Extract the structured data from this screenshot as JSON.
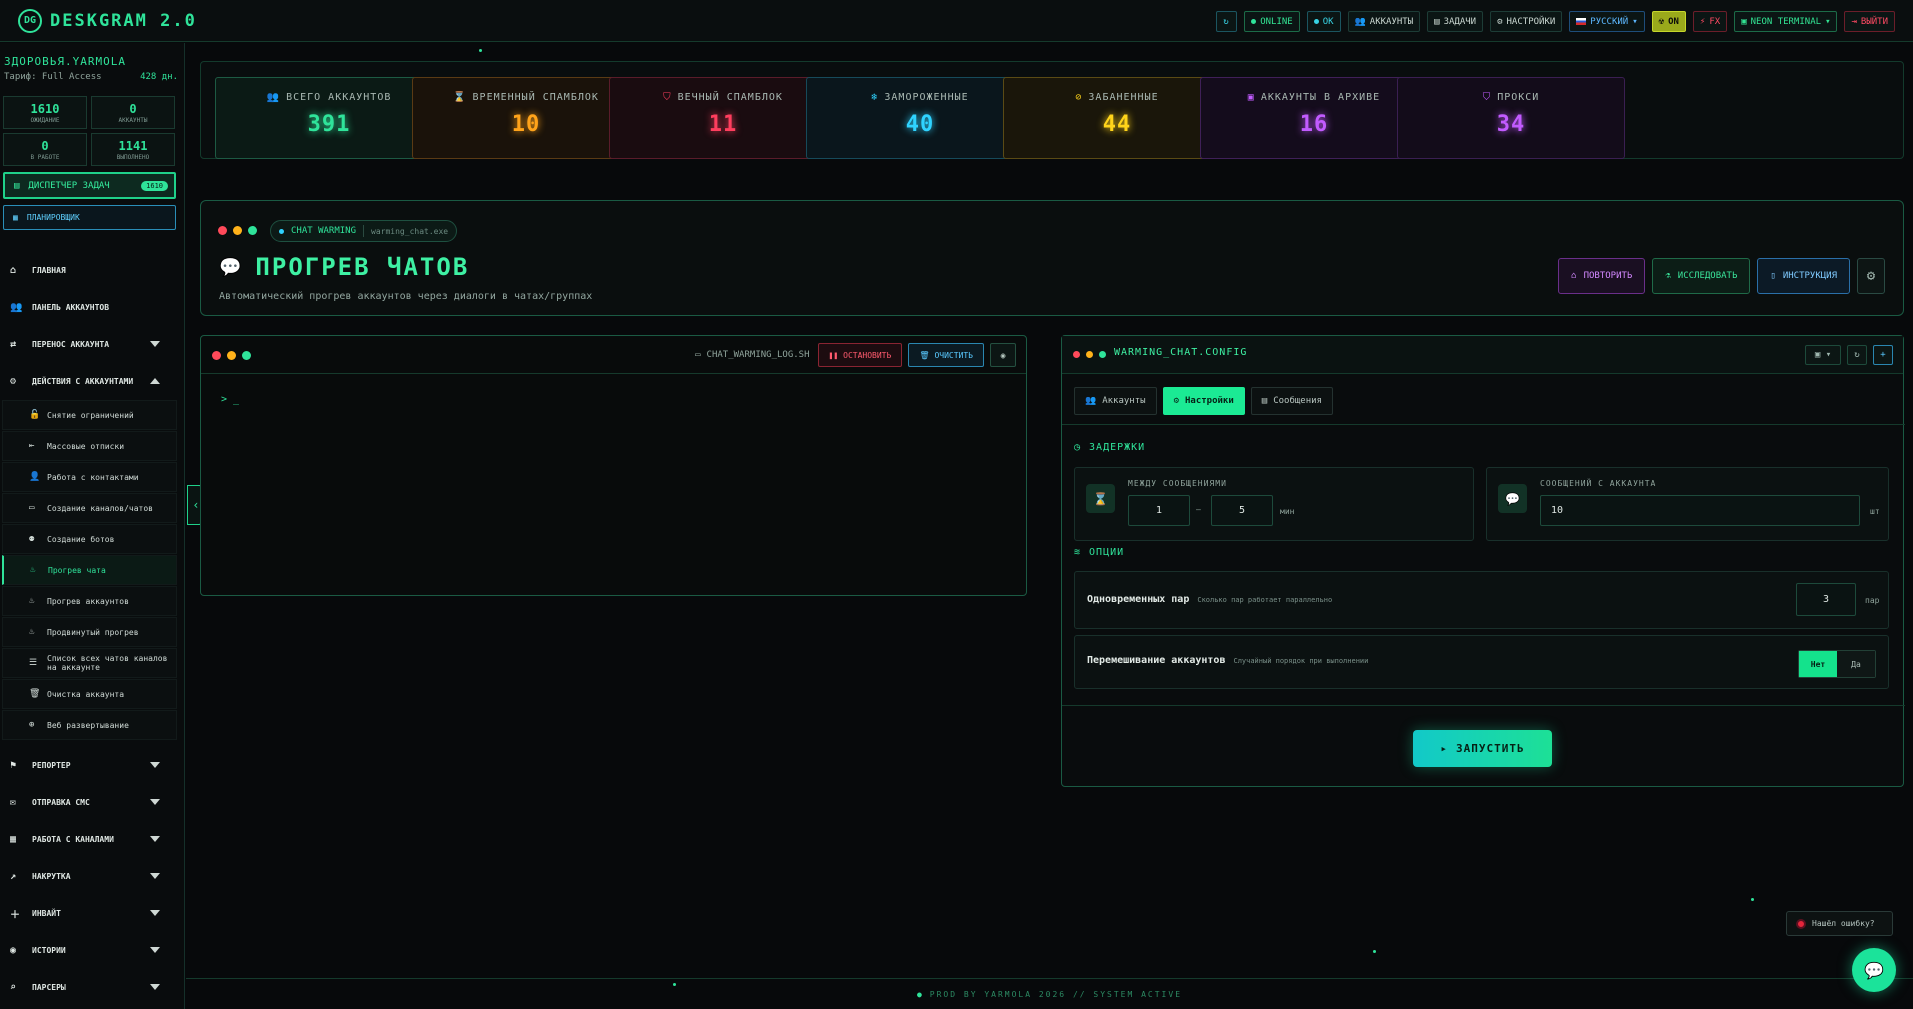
{
  "app": {
    "title": "DESKGRAM 2.0",
    "logo_mark": "DG"
  },
  "topbar": {
    "items": [
      {
        "label": "",
        "icon": "refresh-icon",
        "glyph": "↻"
      },
      {
        "label": "ONLINE",
        "icon": "status-dot"
      },
      {
        "label": "OK",
        "icon": "status-dot"
      },
      {
        "label": "АККАУНТЫ",
        "icon": "users-icon",
        "glyph": "👥"
      },
      {
        "label": "ЗАДАЧИ",
        "icon": "clipboard-icon",
        "glyph": "▤"
      },
      {
        "label": "НАСТРОЙКИ",
        "icon": "gear-icon",
        "glyph": "⚙"
      },
      {
        "label": "РУССКИЙ",
        "icon": "flag-icon"
      },
      {
        "label": "ON",
        "icon": "radiation-icon",
        "glyph": "☢"
      },
      {
        "label": "FX",
        "icon": "bolt-icon",
        "glyph": "⚡"
      },
      {
        "label": "NEON TERMINAL",
        "icon": "terminal-icon",
        "glyph": "▣"
      },
      {
        "label": "ВЫЙТИ",
        "icon": "logout-icon",
        "glyph": "⇥"
      }
    ]
  },
  "sidebar": {
    "user": "ЗДОРОВЬЯ.YARMOLA",
    "tariff_label": "Тариф: Full Access",
    "tariff_days": "428 дн.",
    "stats": [
      {
        "value": "1610",
        "label": "ОЖИДАНИЕ"
      },
      {
        "value": "0",
        "label": "АККАУНТЫ"
      },
      {
        "value": "0",
        "label": "В РАБОТЕ"
      },
      {
        "value": "1141",
        "label": "ВЫПОЛНЕНО"
      }
    ],
    "task_manager": {
      "label": "ДИСПЕТЧЕР ЗАДАЧ",
      "badge": "1610"
    },
    "scheduler": {
      "label": "ПЛАНИРОВЩИК"
    },
    "nav_top": [
      {
        "label": "ГЛАВНАЯ",
        "icon": "home-icon",
        "glyph": "⌂"
      },
      {
        "label": "ПАНЕЛЬ АККАУНТОВ",
        "icon": "users-icon",
        "glyph": "👥"
      },
      {
        "label": "ПЕРЕНОС АККАУНТА",
        "icon": "user-transfer-icon",
        "glyph": "⇄"
      },
      {
        "label": "ДЕЙСТВИЯ С АККАУНТАМИ",
        "icon": "user-gear-icon",
        "glyph": "⚙"
      }
    ],
    "sub_items": [
      {
        "label": "Снятие ограничений",
        "glyph": "🔓"
      },
      {
        "label": "Массовые отписки",
        "glyph": "⇤"
      },
      {
        "label": "Работа с контактами",
        "glyph": "👤"
      },
      {
        "label": "Создание каналов/чатов",
        "glyph": "▭"
      },
      {
        "label": "Создание ботов",
        "glyph": "⚉"
      },
      {
        "label": "Прогрев чата",
        "glyph": "♨"
      },
      {
        "label": "Прогрев аккаунтов",
        "glyph": "♨"
      },
      {
        "label": "Продвинутый прогрев",
        "glyph": "♨"
      },
      {
        "label": "Список всех чатов каналов на аккаунте",
        "glyph": "☰"
      },
      {
        "label": "Очистка аккаунта",
        "glyph": "🗑"
      },
      {
        "label": "Веб развертывание",
        "glyph": "⊕"
      }
    ],
    "nav_bottom": [
      {
        "label": "РЕПОРТЕР",
        "icon": "flag-icon",
        "glyph": "⚑"
      },
      {
        "label": "ОТПРАВКА СМС",
        "icon": "chat-icon",
        "glyph": "✉"
      },
      {
        "label": "РАБОТА С КАНАЛАМИ",
        "icon": "briefcase-icon",
        "glyph": "▦"
      },
      {
        "label": "НАКРУТКА",
        "icon": "chart-icon",
        "glyph": "↗"
      },
      {
        "label": "ИНВАЙТ",
        "icon": "invite-icon",
        "glyph": "＋"
      },
      {
        "label": "ИСТОРИИ",
        "icon": "stories-icon",
        "glyph": "◉"
      },
      {
        "label": "ПАРСЕРЫ",
        "icon": "search-icon",
        "glyph": "⌕"
      }
    ]
  },
  "stat_cards": [
    {
      "label": "ВСЕГО АККАУНТОВ",
      "value": "391",
      "icon": "users-icon",
      "glyph": "👥",
      "color": "#2fe39a",
      "bg": "#0b1a15",
      "border": "#1d5a43"
    },
    {
      "label": "ВРЕМЕННЫЙ СПАМБЛОК",
      "value": "10",
      "icon": "hourglass-icon",
      "glyph": "⌛",
      "color": "#ffa31a",
      "bg": "#1a120a",
      "border": "#5a3a14"
    },
    {
      "label": "ВЕЧНЫЙ СПАМБЛОК",
      "value": "11",
      "icon": "shield-alert-icon",
      "glyph": "⛉",
      "color": "#ff3e5e",
      "bg": "#1a0c10",
      "border": "#5a1c2a"
    },
    {
      "label": "ЗАМОРОЖЕННЫЕ",
      "value": "40",
      "icon": "snowflake-icon",
      "glyph": "❄",
      "color": "#2fd3ff",
      "bg": "#0a161c",
      "border": "#164a5a"
    },
    {
      "label": "ЗАБАНЕННЫЕ",
      "value": "44",
      "icon": "ban-icon",
      "glyph": "⊘",
      "color": "#ffd41a",
      "bg": "#1a160a",
      "border": "#5a4a14"
    },
    {
      "label": "АККАУНТЫ В АРХИВЕ",
      "value": "16",
      "icon": "archive-icon",
      "glyph": "▣",
      "color": "#c25bff",
      "bg": "#140c1c",
      "border": "#3f2058"
    },
    {
      "label": "ПРОКСИ",
      "value": "34",
      "icon": "shield-icon",
      "glyph": "⛉",
      "color": "#c25bff",
      "bg": "#130c1a",
      "border": "#3a1f52"
    }
  ],
  "hero": {
    "pill_label": "CHAT WARMING",
    "pill_exe": "warming_chat.exe",
    "title": "ПРОГРЕВ ЧАТОВ",
    "subtitle": "Автоматический прогрев аккаунтов через диалоги в чатах/группах",
    "buttons": [
      "ПОВТОРИТЬ",
      "ИССЛЕДОВАТЬ",
      "ИНСТРУКЦИЯ"
    ]
  },
  "terminal": {
    "file": "CHAT_WARMING_LOG.SH",
    "stop": "ОСТАНОВИТЬ",
    "clear": "ОЧИСТИТЬ",
    "prompt": "> _"
  },
  "config": {
    "title": "WARMING_CHAT.CONFIG",
    "tabs": [
      "Аккаунты",
      "Настройки",
      "Сообщения"
    ],
    "active_tab": "Настройки",
    "delays_title": "ЗАДЕРЖКИ",
    "between_label": "МЕЖДУ СООБЩЕНИЯМИ",
    "between_min": "1",
    "between_dash": "—",
    "between_max": "5",
    "between_unit": "мин",
    "per_account_label": "СООБЩЕНИЙ С АККАУНТА",
    "per_account_value": "10",
    "per_account_unit": "шт",
    "options_title": "ОПЦИИ",
    "pairs_label": "Одновременных пар",
    "pairs_desc": "Сколько пар работает параллельно",
    "pairs_value": "3",
    "pairs_unit": "пар",
    "shuffle_label": "Перемешивание аккаунтов",
    "shuffle_desc": "Случайный порядок при выполнении",
    "shuffle_no": "Нет",
    "shuffle_yes": "Да",
    "launch": "ЗАПУСТИТЬ"
  },
  "footer": {
    "text": "PROD BY YARMOLA 2026   // SYSTEM ACTIVE"
  },
  "error_button": {
    "label": "Нашёл ошибку?"
  }
}
